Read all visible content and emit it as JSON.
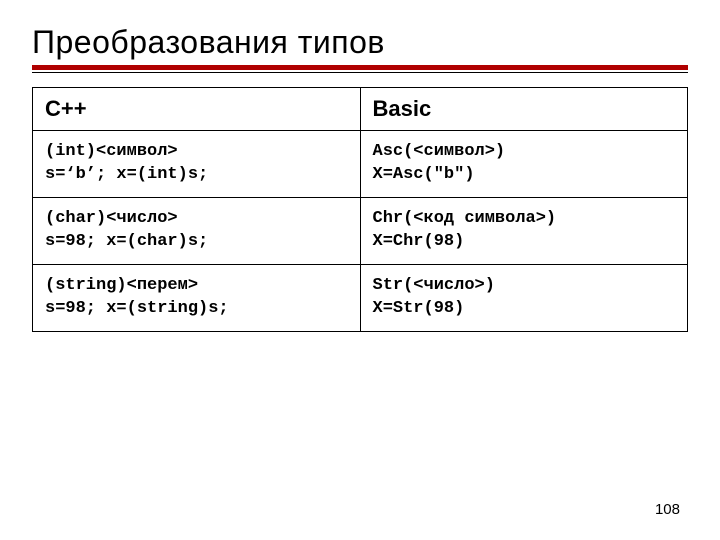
{
  "title": "Преобразования типов",
  "table": {
    "headers": {
      "left": "C++",
      "right": "Basic"
    },
    "rows": [
      {
        "left": {
          "l1": "(int)<символ>",
          "l2": "s=‘b’; x=(int)s;"
        },
        "right": {
          "l1": "Asc(<символ>)",
          "l2": "X=Asc(\"b\")"
        }
      },
      {
        "left": {
          "l1": "(char)<число>",
          "l2": "s=98; x=(char)s;"
        },
        "right": {
          "l1": "Chr(<код символа>)",
          "l2": "X=Chr(98)"
        }
      },
      {
        "left": {
          "l1": "(string)<перем>",
          "l2": "s=98; x=(string)s;"
        },
        "right": {
          "l1": "Str(<число>)",
          "l2": "X=Str(98)"
        }
      }
    ]
  },
  "page_number": "108"
}
